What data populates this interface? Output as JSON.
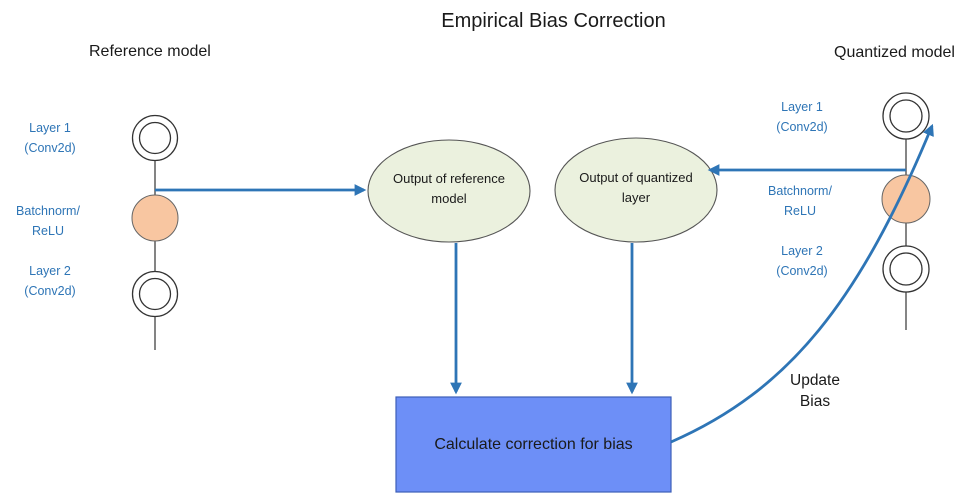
{
  "diagram": {
    "title": "Empirical Bias Correction",
    "reference_model": {
      "label": "Reference model",
      "layer1": [
        "Layer 1",
        "(Conv2d)"
      ],
      "batchnorm": [
        "Batchnorm/",
        "ReLU"
      ],
      "layer2": [
        "Layer 2",
        "(Conv2d)"
      ]
    },
    "quantized_model": {
      "label": "Quantized model",
      "layer1": [
        "Layer 1",
        "(Conv2d)"
      ],
      "batchnorm": [
        "Batchnorm/",
        "ReLU"
      ],
      "layer2": [
        "Layer 2",
        "(Conv2d)"
      ]
    },
    "output_reference": [
      "Output of reference",
      "model"
    ],
    "output_quantized": [
      "Output of quantized",
      "layer"
    ],
    "calculate": "Calculate correction for bias",
    "update": [
      "Update",
      "Bias"
    ],
    "colors": {
      "arrow": "#2e75b6",
      "layer_text": "#2e75b6",
      "output_node_fill": "#ebf1de",
      "batchnorm_fill": "#f8c6a1",
      "calc_box_fill": "#6d8ff7",
      "calc_box_border": "#3d5fb8"
    }
  }
}
